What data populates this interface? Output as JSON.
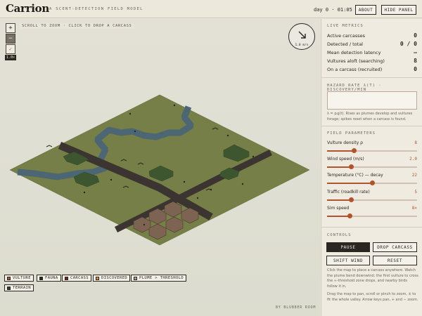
{
  "header": {
    "brand": "Carrion",
    "tagline": "A SCENT-DETECTION FIELD MODEL",
    "clock": "day 0 · 01:05",
    "about_label": "ABOUT",
    "hide_panel_label": "HIDE PANEL"
  },
  "map": {
    "hint": "SCROLL TO ZOOM · CLICK TO DROP A CARCASS",
    "zoom_in": "+",
    "zoom_out": "−",
    "zoom_check": "✓",
    "zoom_level": "1.0×",
    "wind_speed": "1.0 m/s",
    "credit": "BY BLUBBER ROOM"
  },
  "legend": [
    {
      "label": "VULTURE",
      "color": "#b0542e"
    },
    {
      "label": "FAUNA",
      "color": "#2a2622"
    },
    {
      "label": "CARCASS",
      "color": "#7a1f1a"
    },
    {
      "label": "DISCOVERED",
      "color": "#d98a3a"
    },
    {
      "label": "PLUME > THRESHOLD",
      "color": "#a8a08c"
    },
    {
      "label": "TERRAIN",
      "color": "#3e3a33"
    }
  ],
  "metrics": {
    "title": "LIVE METRICS",
    "rows": [
      {
        "label": "Active carcasses",
        "value": "0"
      },
      {
        "label": "Detected / total",
        "value": "0 / 0"
      },
      {
        "label": "Mean detection latency",
        "value": "—"
      },
      {
        "label": "Vultures aloft (searching)",
        "value": "8"
      },
      {
        "label": "On a carcass (recruited)",
        "value": "0"
      }
    ]
  },
  "hazard": {
    "title": "HAZARD RATE λ(T) · DISCOVERY/MIN",
    "note": "λ = pᵢg(t). Rises as plumes develop and vultures forage; spikes reset when a carcass is found."
  },
  "params": {
    "title": "FIELD PARAMETERS",
    "items": [
      {
        "label": "Vulture density ρ",
        "value": "8",
        "fraction": 0.3
      },
      {
        "label": "Wind speed (m/s)",
        "value": "2.0",
        "fraction": 0.27
      },
      {
        "label": "Temperature (°C) — decay",
        "value": "22",
        "fraction": 0.5
      },
      {
        "label": "Traffic (roadkill rate)",
        "value": "5",
        "fraction": 0.27
      },
      {
        "label": "Sim speed",
        "value": "8×",
        "fraction": 0.25
      }
    ]
  },
  "controls": {
    "title": "CONTROLS",
    "pause": "PAUSE",
    "drop": "DROP CARCASS",
    "shift": "SHIFT WIND",
    "reset": "RESET",
    "help1": "Click the map to place a carcass anywhere. Watch the plume bend downwind; the first vulture to cross the ≈-threshold zone drops, and nearby birds follow it in.",
    "help2": "Drag the map to pan, scroll or pinch to zoom, ± to fit the whole valley. Arrow keys pan, + and − zoom."
  },
  "colors": {
    "accent": "#b0542e",
    "grass": "#757f47",
    "water": "#4c6674",
    "road": "#3b3430"
  }
}
